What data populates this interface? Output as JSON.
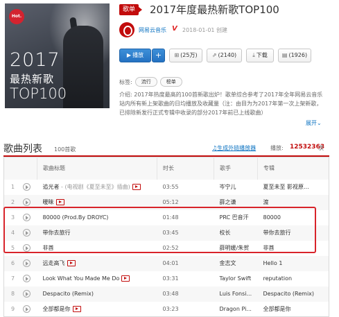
{
  "cover": {
    "hot_badge": "Hot.",
    "year": "2017",
    "line1": "最热新歌",
    "line2": "TOP100"
  },
  "header": {
    "type_badge": "歌单",
    "title": "2017年度最热新歌TOP100",
    "creator": "网易云音乐",
    "creator_mark": "V",
    "date": "2018-01-01 创建"
  },
  "actions": {
    "play": "播放",
    "add": "+",
    "favorite": "(25万)",
    "share": "(2140)",
    "download": "下载",
    "comment": "(1926)"
  },
  "tags": {
    "label": "标签:",
    "items": [
      "流行",
      "榜单"
    ]
  },
  "description": "介绍:  2017年热度最高的100首新歌出炉！歌单综合参考了2017年全年网易云音乐站内所有新上架歌曲的日均播放及收藏量（注：由目为为2017年第一次上架新歌，已排除新发行正式专辑中收录的部分2017年前已上线歌曲）",
  "expand": "展开",
  "list": {
    "title": "歌曲列表",
    "count": "100首歌",
    "gen_link": "生成外链播放器",
    "play_label": "播放:",
    "play_count": "12532363",
    "play_unit": "次",
    "columns": [
      "",
      "歌曲标题",
      "时长",
      "歌手",
      "专辑"
    ],
    "rows": [
      {
        "idx": "1",
        "title": "追光者",
        "alias": " - (电视剧《夏至未至》插曲)",
        "mv": true,
        "dur": "03:55",
        "artist": "岑宁儿",
        "album": "夏至未至 影视原..."
      },
      {
        "idx": "2",
        "title": "暧昧",
        "alias": "",
        "mv": true,
        "dur": "05:12",
        "artist": "薛之谦",
        "album": "渡"
      },
      {
        "idx": "3",
        "title": "80000  (Prod.By DROYC)",
        "alias": "",
        "mv": false,
        "dur": "01:48",
        "artist": "PRC 巴音汗",
        "album": "80000"
      },
      {
        "idx": "4",
        "title": "带你去旅行",
        "alias": "",
        "mv": false,
        "dur": "03:45",
        "artist": "校长",
        "album": "带你去旅行"
      },
      {
        "idx": "5",
        "title": "非酋",
        "alias": "",
        "mv": false,
        "dur": "02:52",
        "artist": "薛明媛/朱贺",
        "album": "非酋"
      },
      {
        "idx": "6",
        "title": "远走高飞",
        "alias": "",
        "mv": true,
        "dur": "04:01",
        "artist": "金志文",
        "album": "Hello 1"
      },
      {
        "idx": "7",
        "title": "Look What You Made Me Do",
        "alias": "",
        "mv": true,
        "dur": "03:31",
        "artist": "Taylor Swift",
        "album": "reputation"
      },
      {
        "idx": "8",
        "title": "Despacito (Remix)",
        "alias": "",
        "mv": false,
        "dur": "03:48",
        "artist": "Luis Fonsi...",
        "album": "Despacito (Remix)"
      },
      {
        "idx": "9",
        "title": "全部都是你",
        "alias": "",
        "mv": true,
        "dur": "03:23",
        "artist": "Dragon Pi...",
        "album": "全部都是你"
      }
    ]
  },
  "colors": {
    "accent_red": "#c20c0c",
    "link_blue": "#0c73c2",
    "highlight_box": "#d8232a"
  }
}
